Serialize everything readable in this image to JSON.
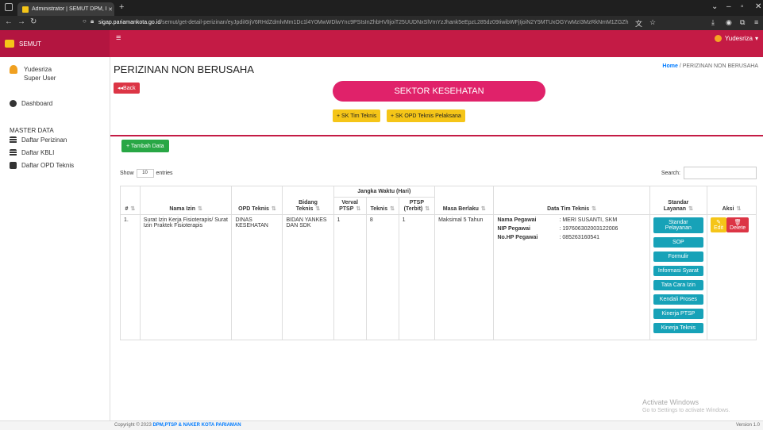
{
  "browser": {
    "tab_title": "Administrator | SEMUT DPM, P",
    "url_domain": "sigap.pariamankota.go.id",
    "url_path": "/semut/get-detail-perizinan/eyJpdiI6IjV6RHdZdmlvMm1Dc1l4Y0MwWDlwYnc9PSIsInZhbHVlIjoiT25UUDNxSlVmYzJhank5eEpzL285dz09IiwibWFjIjoiN2Y5MTUxOGYwMzI3MzRkNmM1ZGZh"
  },
  "topbar": {
    "brand": "SEMUT",
    "user": "Yudesriza"
  },
  "sidebar": {
    "user_name": "Yudesriza",
    "user_role": "Super User",
    "dashboard": "Dashboard",
    "section": "MASTER DATA",
    "items": [
      "Daftar Perizinan",
      "Daftar KBLI",
      "Daftar OPD Teknis"
    ]
  },
  "page": {
    "title": "PERIZINAN NON BERUSAHA",
    "breadcrumb_home": "Home",
    "breadcrumb_current": "PERIZINAN NON BERUSAHA",
    "back": "Back",
    "sektor": "SEKTOR KESEHATAN",
    "sk_tim": "+ SK Tim Teknis",
    "sk_opd": "+ SK OPD Teknis Pelaksana",
    "tambah": "+ Tambah Data",
    "show_label": "Show",
    "entries_value": "10",
    "entries_label": "entries",
    "search_label": "Search:"
  },
  "table": {
    "group_header": "Jangka Waktu (Hari)",
    "headers": {
      "no": "#",
      "nama": "Nama Izin",
      "opd": "OPD Teknis",
      "bidang": "Bidang Teknis",
      "verval": "Verval PTSP",
      "teknis": "Teknis",
      "ptsp": "PTSP (Terbit)",
      "masa": "Masa Berlaku",
      "tim": "Data Tim Teknis",
      "standar": "Standar Layanan",
      "aksi": "Aksi"
    },
    "rows": [
      {
        "no": "1.",
        "nama": "Surat Izin Kerja Fisioterapis/ Surat Izin Praktek Fisioterapis",
        "opd": "DINAS KESEHATAN",
        "bidang": "BIDAN YANKES DAN SDK",
        "verval": "1",
        "teknis": "8",
        "ptsp": "1",
        "masa": "Maksimal 5 Tahun",
        "tim_labels": [
          "Nama Pegawai",
          "NIP Pegawai",
          "No.HP Pegawai"
        ],
        "tim_values": [
          ": MERI SUSANTI, SKM",
          ": 197606302003122006",
          ": 085263160541"
        ],
        "standar": [
          "Standar Pelayanan",
          "SOP",
          "Formulir",
          "Informasi Syarat",
          "Tata Cara Izin",
          "Kendali Proses",
          "Kinerja PTSP",
          "Kinerja Teknis"
        ],
        "edit": "Edit",
        "delete": "Delete"
      }
    ]
  },
  "footer": {
    "copyright": "Copyright © 2023",
    "org": "DPM,PTSP & NAKER KOTA PARIAMAN",
    "version": "Version 1.0"
  },
  "watermark": {
    "line1": "Activate Windows",
    "line2": "Go to Settings to activate Windows."
  }
}
